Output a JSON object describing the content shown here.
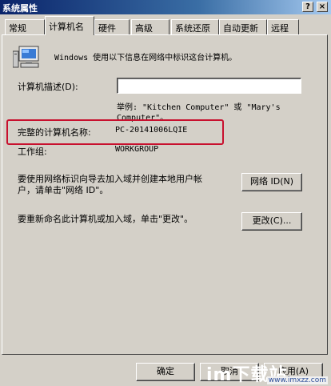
{
  "window": {
    "title": "系统属性",
    "help_glyph": "?",
    "close_glyph": "×"
  },
  "tabs": [
    {
      "label": "常规"
    },
    {
      "label": "计算机名"
    },
    {
      "label": "硬件"
    },
    {
      "label": "高级"
    },
    {
      "label": "系统还原"
    },
    {
      "label": "自动更新"
    },
    {
      "label": "远程"
    }
  ],
  "computer_name_tab": {
    "intro": "Windows 使用以下信息在网络中标识这台计算机。",
    "description_label": "计算机描述(D):",
    "description_value": "",
    "example_line1": "举例: \"Kitchen Computer\" 或 \"Mary's",
    "example_line2": "Computer\"。",
    "full_name_label": "完整的计算机名称:",
    "full_name_value": "PC-20141006LQIE",
    "workgroup_label": "工作组:",
    "workgroup_value": "WORKGROUP",
    "network_id_text_line1": "要使用网络标识向导去加入域并创建本地用户帐",
    "network_id_text_line2": "户，请单击\"网络 ID\"。",
    "network_id_button": "网络 ID(N)",
    "rename_text": "要重新命名此计算机或加入域，单击\"更改\"。",
    "change_button": "更改(C)..."
  },
  "footer": {
    "ok_button": "确定",
    "cancel_button": "取消",
    "apply_button": "应用(A)"
  },
  "watermark": {
    "text": "im下载站",
    "sub": "www.imxzz.com"
  },
  "colors": {
    "highlight": "#c8102e",
    "titlebar": "#0a246a",
    "face": "#d4d0c8"
  }
}
